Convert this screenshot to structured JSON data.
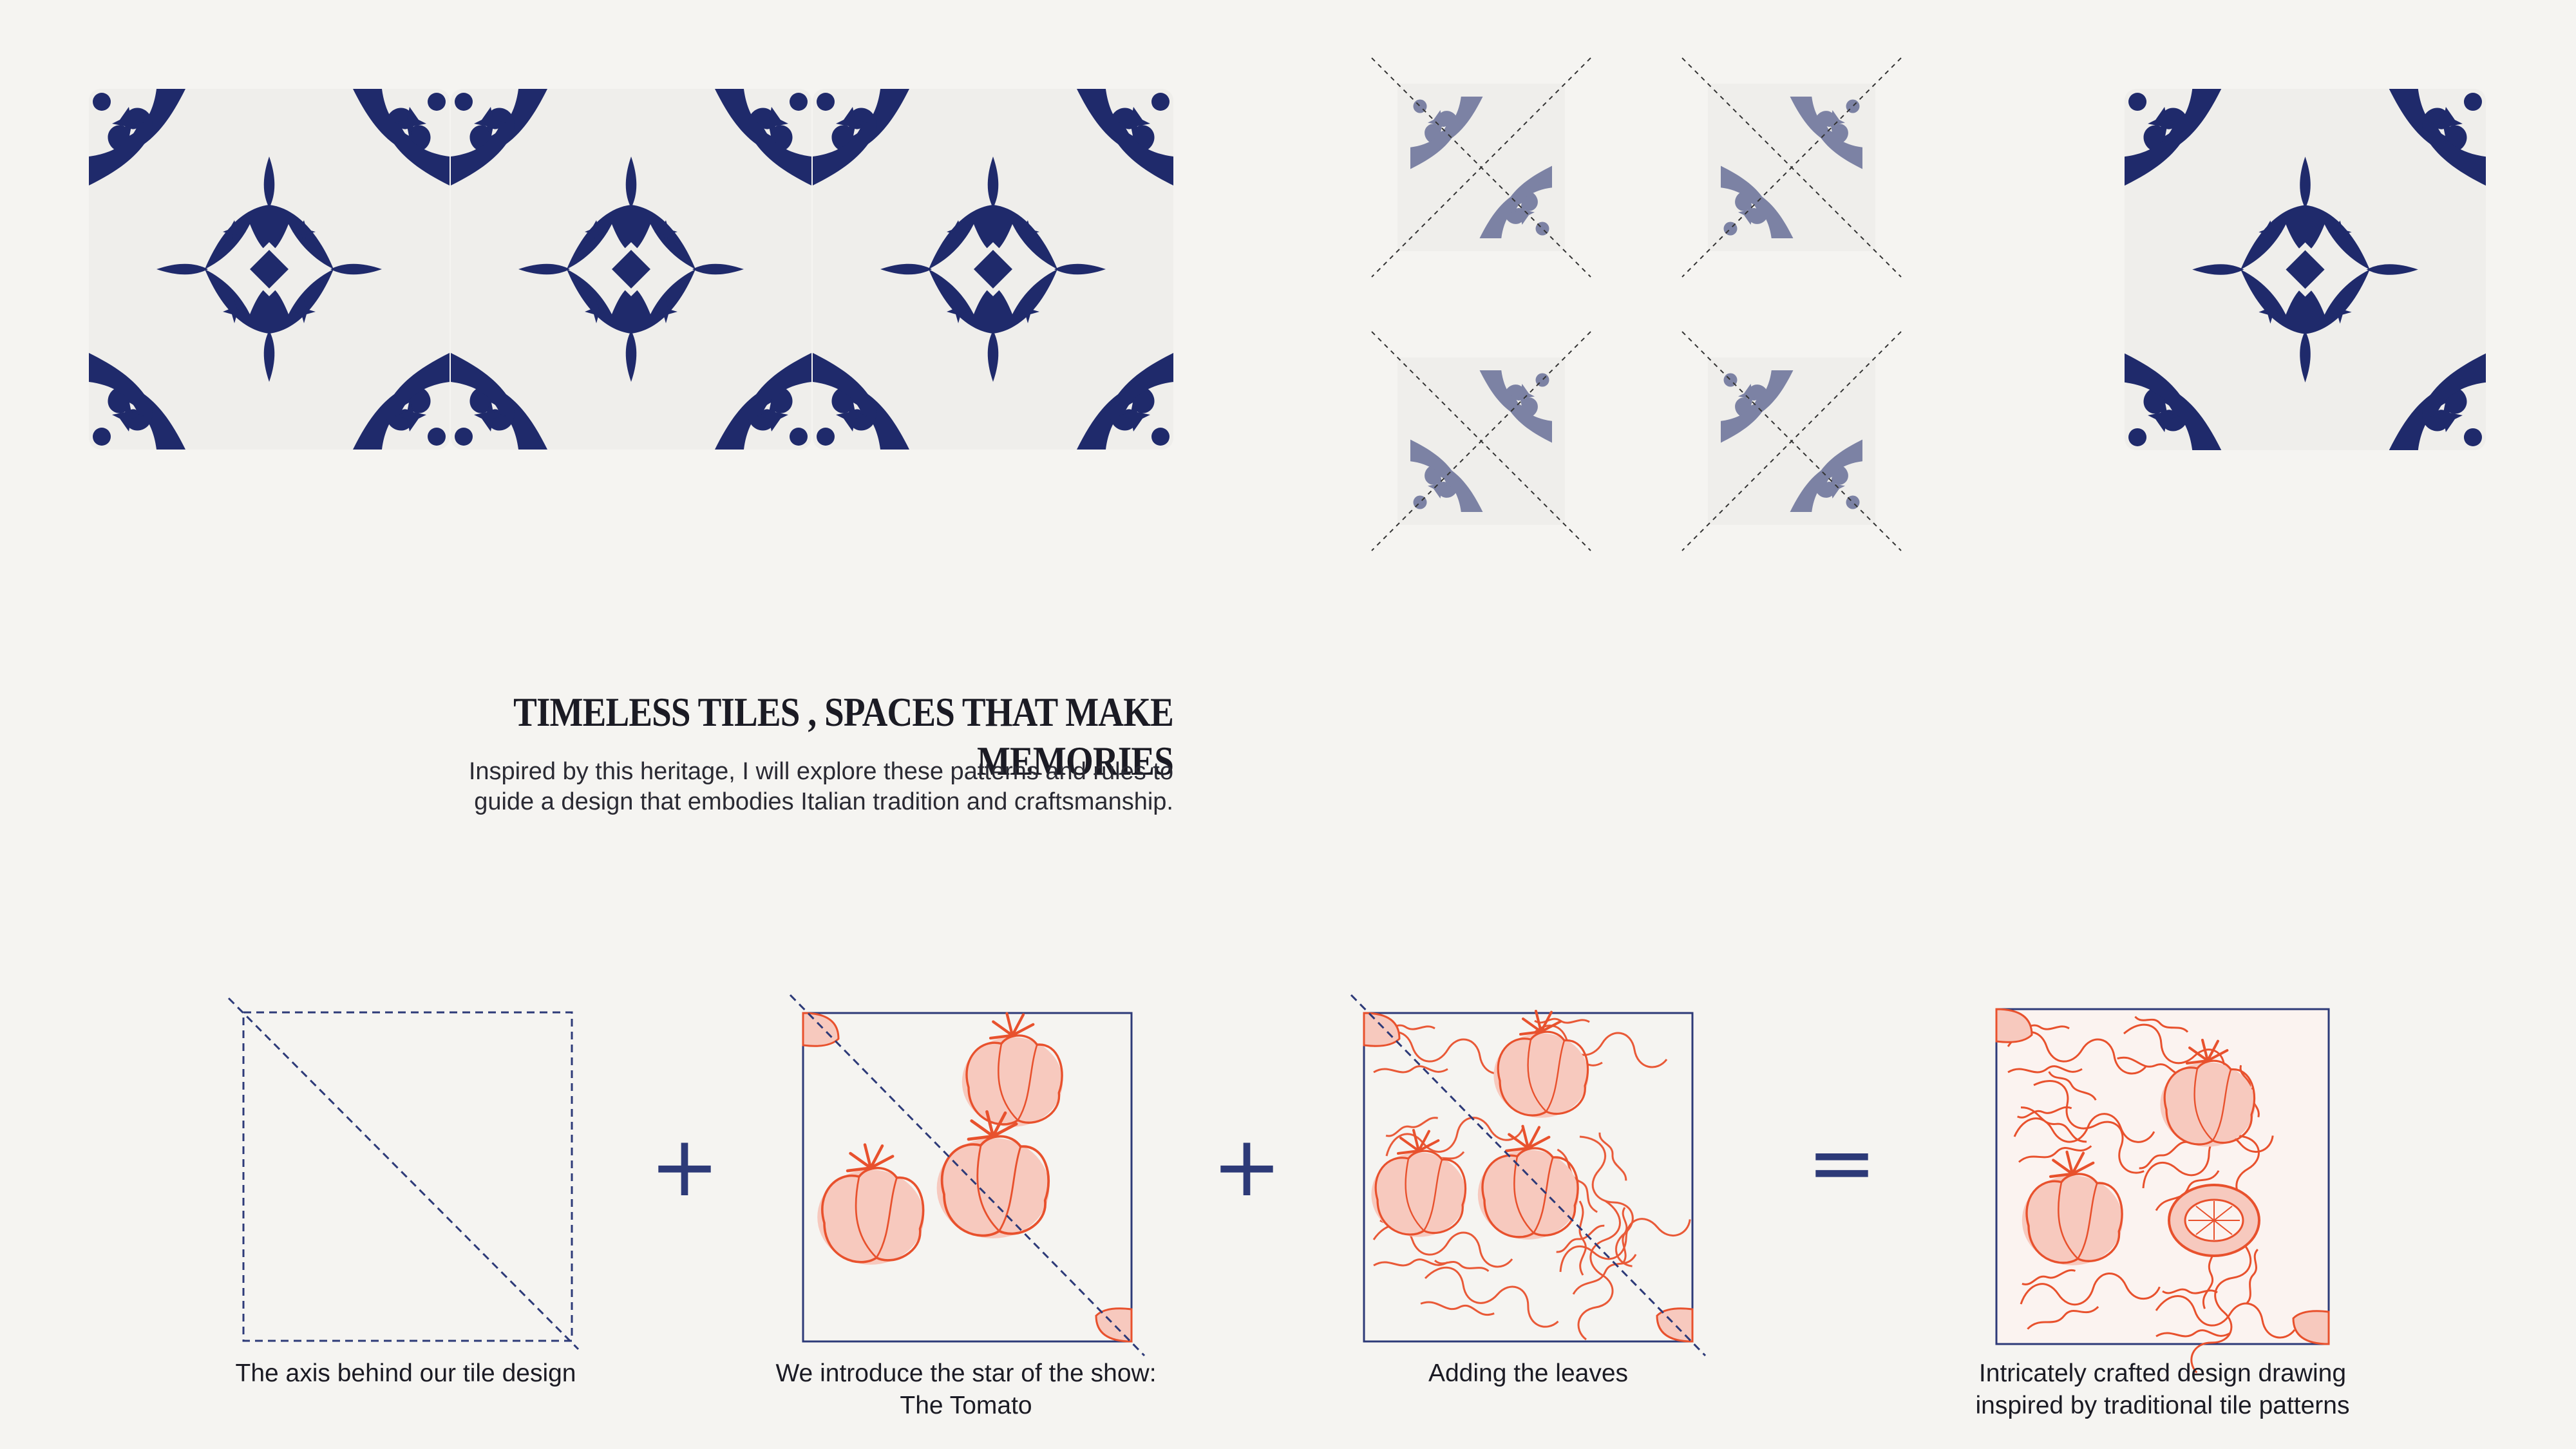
{
  "colors": {
    "background": "#f5f4f1",
    "tile_blue": "#1f2a6b",
    "tile_white": "#efeeeb",
    "tomato_line": "#e8512d",
    "tomato_fill": "#f7c9be",
    "frame_navy": "#2d3a78",
    "faded_blue": "#7f89b3"
  },
  "header": {
    "title": "TIMELESS TILES , SPACES THAT MAKE MEMORIES",
    "description": "Inspired by this heritage, I will explore these patterns and rules to guide a design that embodies Italian tradition and craftsmanship."
  },
  "process": {
    "operators": [
      "+",
      "+",
      "="
    ],
    "steps": [
      {
        "caption_line1": "The axis behind our tile design",
        "caption_line2": "",
        "icon": "dashed-axis-square"
      },
      {
        "caption_line1": "We introduce the star of the show:",
        "caption_line2": "The Tomato",
        "icon": "tomato-sketch"
      },
      {
        "caption_line1": "Adding the leaves",
        "caption_line2": "",
        "icon": "leaf-sketch"
      },
      {
        "caption_line1": "Intricately crafted design drawing",
        "caption_line2": "inspired by traditional tile patterns",
        "icon": "final-tile"
      }
    ]
  }
}
